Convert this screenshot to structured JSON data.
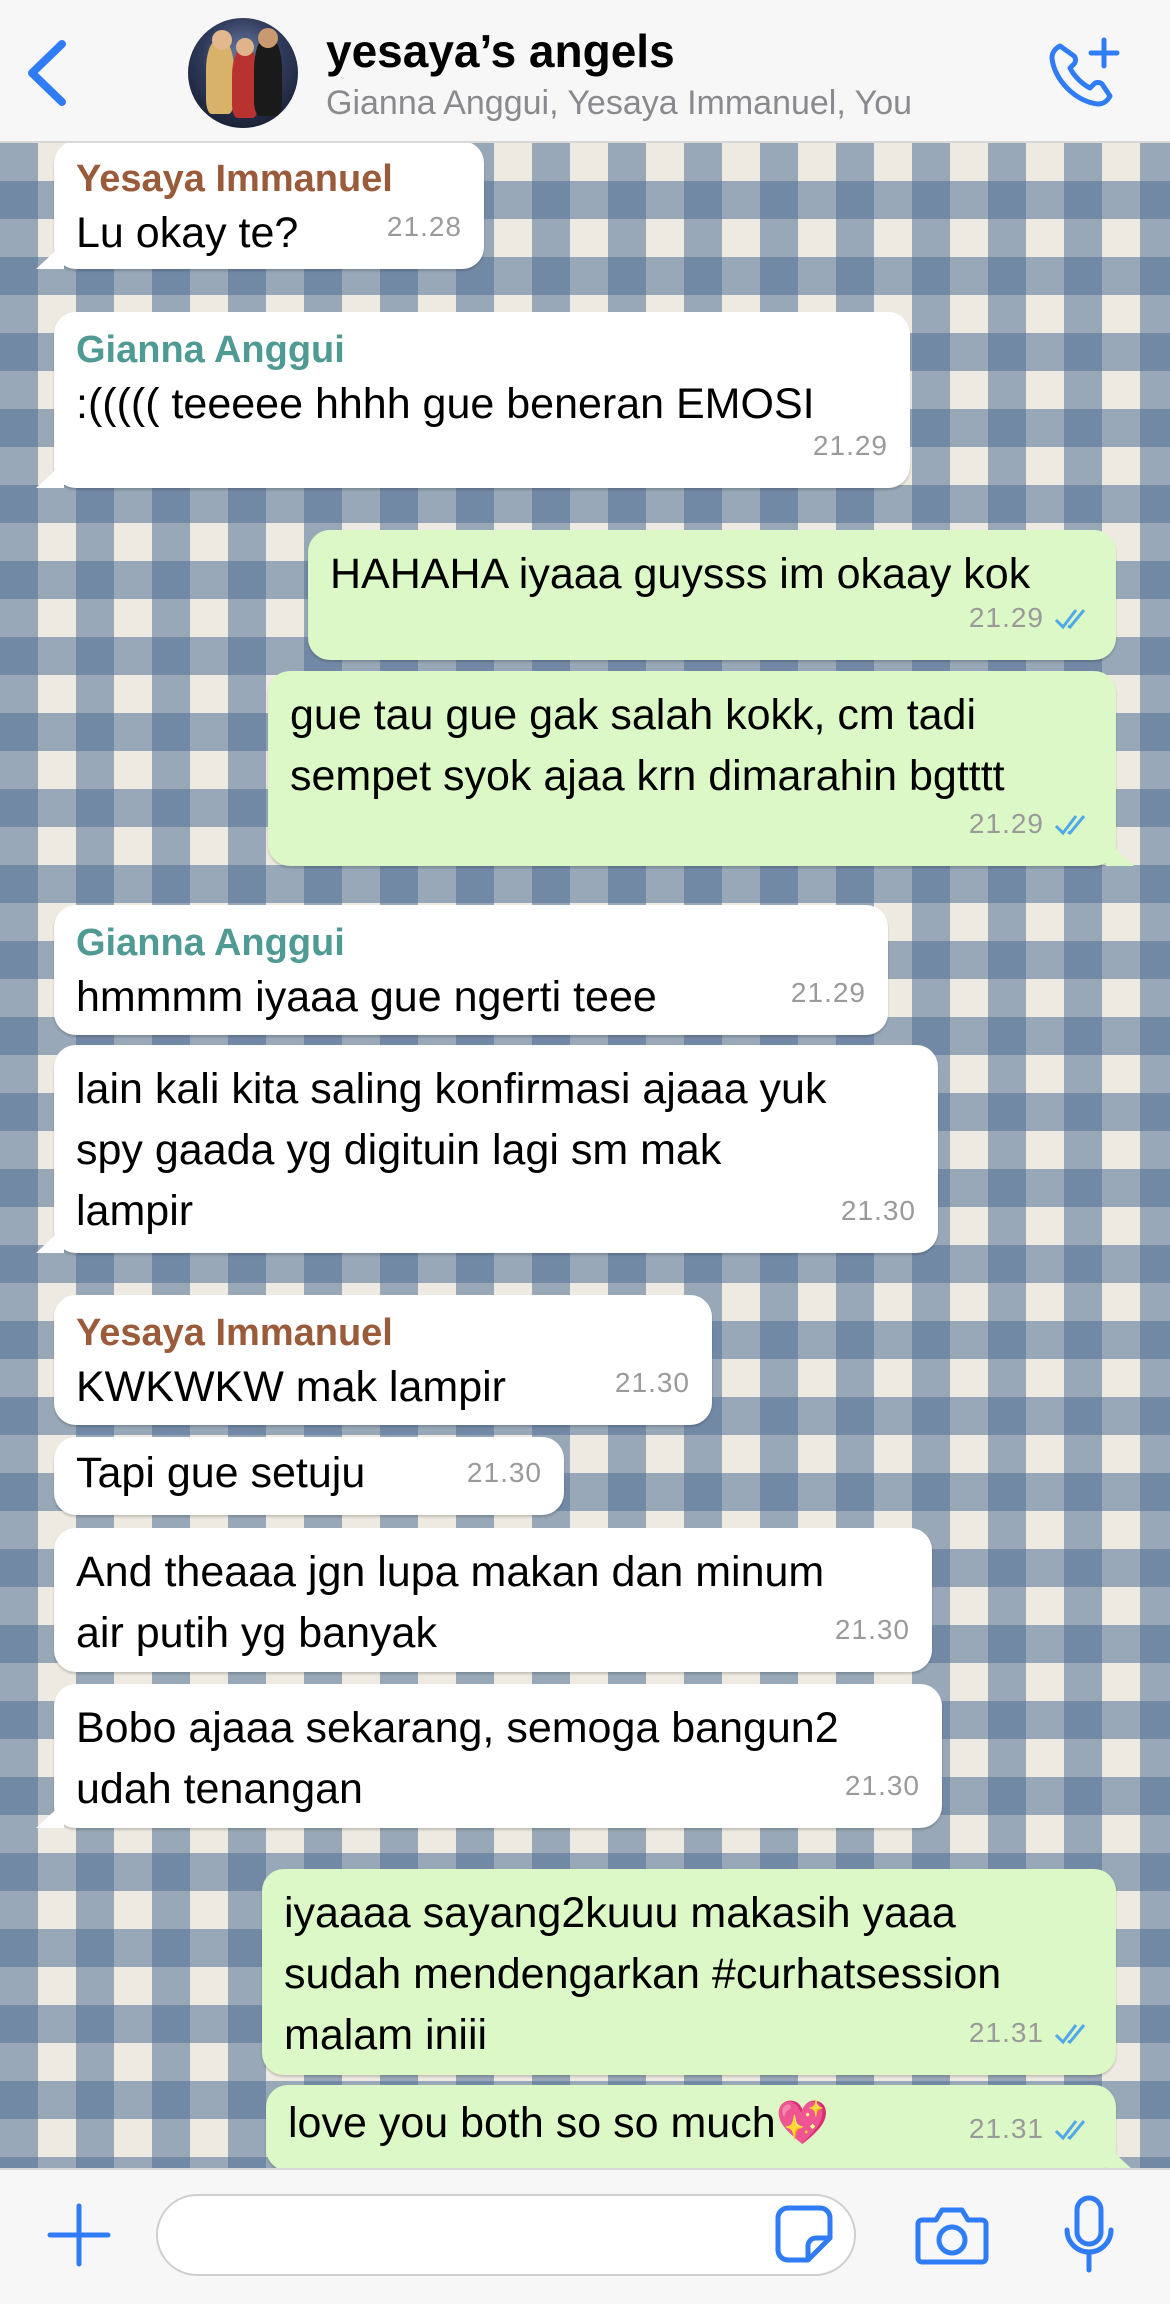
{
  "header": {
    "title": "yesaya’s angels",
    "subtitle": "Gianna Anggui, Yesaya Immanuel, You"
  },
  "colors": {
    "accent": "#2f7cf6",
    "sender_yesaya": "#9a5b3a",
    "sender_gianna": "#4f9a92",
    "outgoing_bubble": "#dcf8c6",
    "incoming_bubble": "#ffffff",
    "read_ticks": "#4fa8e8"
  },
  "messages": [
    {
      "sender": "Yesaya Immanuel",
      "text": "Lu okay te?",
      "time": "21.28"
    },
    {
      "sender": "Gianna Anggui",
      "text": ":((((( teeeee hhhh gue beneran EMOSI",
      "time": "21.29"
    },
    {
      "text": "HAHAHA iyaaa guysss im okaay kok",
      "time": "21.29"
    },
    {
      "text": "gue tau gue gak salah kokk, cm tadi\nsempet syok ajaa krn dimarahin bgtttt",
      "time": "21.29"
    },
    {
      "sender": "Gianna Anggui",
      "text": "hmmmm iyaaa gue ngerti teee",
      "time": "21.29"
    },
    {
      "text": "lain kali kita saling konfirmasi ajaaa yuk\nspy gaada yg digituin lagi sm mak\nlampir",
      "time": "21.30"
    },
    {
      "sender": "Yesaya Immanuel",
      "text": "KWKWKW mak lampir",
      "time": "21.30"
    },
    {
      "text": "Tapi gue setuju",
      "time": "21.30"
    },
    {
      "text": "And theaaa jgn lupa makan dan minum\nair putih yg banyak",
      "time": "21.30"
    },
    {
      "text": "Bobo ajaaa sekarang, semoga bangun2\nudah tenangan",
      "time": "21.30"
    },
    {
      "text": "iyaaaa sayang2kuuu makasih yaaa\nsudah mendengarkan #curhatsession\nmalam iniii",
      "time": "21.31"
    },
    {
      "text": "love you both so so much💖",
      "time": "21.31"
    }
  ]
}
